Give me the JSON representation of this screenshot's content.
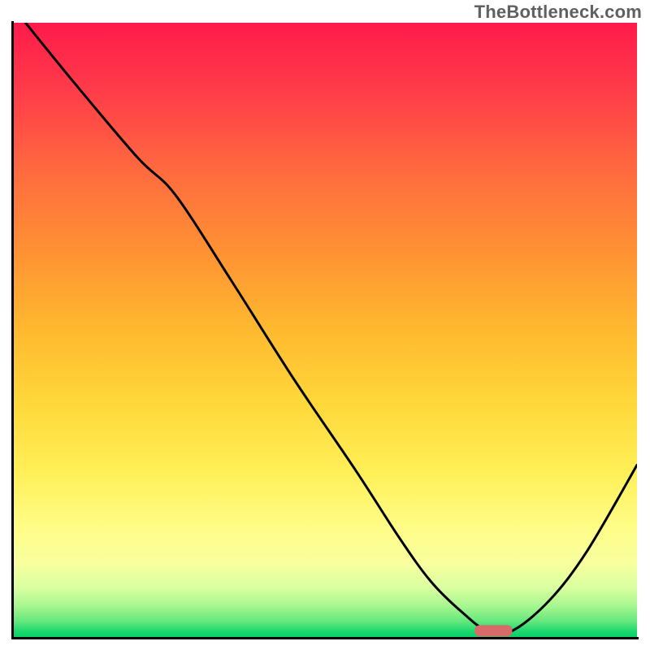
{
  "watermark": "TheBottleneck.com",
  "colors": {
    "gradient_top": "#ff1a4b",
    "gradient_mid": "#ffd83a",
    "gradient_bottom": "#0ad06a",
    "curve": "#000000",
    "marker": "#d86a6a",
    "axis": "#000000"
  },
  "chart_data": {
    "type": "line",
    "title": "",
    "xlabel": "",
    "ylabel": "",
    "xlim": [
      0,
      100
    ],
    "ylim": [
      0,
      100
    ],
    "series": [
      {
        "name": "curve",
        "x": [
          2,
          10,
          20,
          26,
          35,
          45,
          55,
          62,
          67,
          72,
          76,
          80,
          86,
          92,
          100
        ],
        "y": [
          100,
          90,
          78,
          72,
          58,
          42,
          27,
          16,
          9,
          4,
          1,
          1,
          6,
          14,
          28
        ]
      }
    ],
    "markers": [
      {
        "name": "optimal-region",
        "x_center": 77,
        "y": 1,
        "width": 6
      }
    ],
    "annotations": []
  }
}
